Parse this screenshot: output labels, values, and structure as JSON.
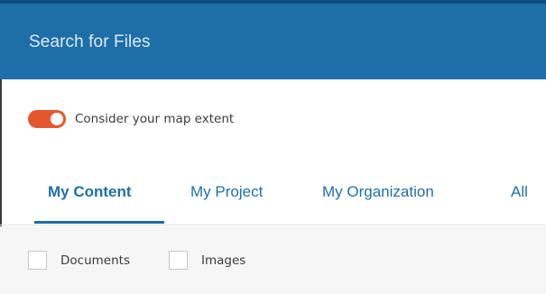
{
  "header": {
    "title": "Search for Files",
    "color": "#1e6fa8"
  },
  "map_extent_toggle": {
    "label": "Consider your map extent",
    "enabled": true,
    "color": "#e4572e"
  },
  "tabs": [
    {
      "label": "My Content",
      "active": true
    },
    {
      "label": "My Project",
      "active": false
    },
    {
      "label": "My Organization",
      "active": false
    },
    {
      "label": "All",
      "active": false
    }
  ],
  "filters": [
    {
      "label": "Documents",
      "checked": false
    },
    {
      "label": "Images",
      "checked": false
    }
  ]
}
